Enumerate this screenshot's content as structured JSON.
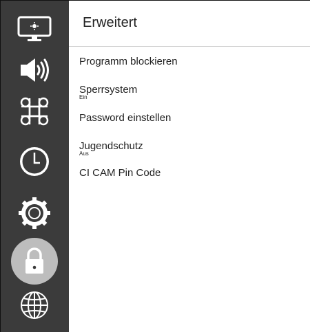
{
  "header": {
    "title": "Erweitert"
  },
  "sidebar": {
    "items": [
      {
        "icon": "monitor-icon",
        "selected": false
      },
      {
        "icon": "speaker-icon",
        "selected": false
      },
      {
        "icon": "command-icon",
        "selected": false
      },
      {
        "icon": "clock-icon",
        "selected": false
      },
      {
        "icon": "settings-gear-icon",
        "selected": false
      },
      {
        "icon": "lock-icon",
        "selected": true
      },
      {
        "icon": "globe-icon",
        "selected": false
      }
    ],
    "colors": {
      "background": "#3b3b3b",
      "selected": "#bdbdbd",
      "icon": "#ffffff"
    }
  },
  "menu": {
    "items": [
      {
        "label": "Programm blockieren",
        "value": ""
      },
      {
        "label": "Sperrsystem",
        "value": "Ein"
      },
      {
        "label": "Password einstellen",
        "value": ""
      },
      {
        "label": "Jugendschutz",
        "value": "Aus"
      },
      {
        "label": "CI CAM Pin Code",
        "value": ""
      }
    ]
  }
}
